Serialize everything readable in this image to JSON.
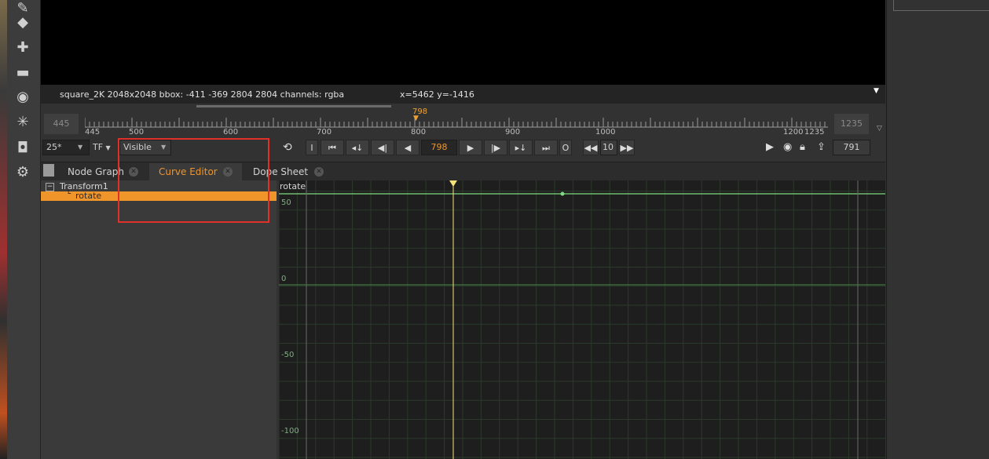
{
  "viewer": {
    "info": "square_2K 2048x2048  bbox: -411 -369 2804 2804 channels: rgba",
    "coords": "x=5462 y=-1416"
  },
  "timeline": {
    "in_frame": "445",
    "out_frame": "1235",
    "current_marker": "798",
    "tick_labels": [
      "445",
      "500",
      "600",
      "700",
      "800",
      "900",
      "1000",
      "1200",
      "1235"
    ]
  },
  "transport": {
    "fps": "25*",
    "tf": "TF",
    "visible": "Visible",
    "current_frame": "798",
    "step": "10",
    "end_frame": "791",
    "i_label": "I",
    "o_label": "O"
  },
  "tabs": [
    {
      "label": "Node Graph"
    },
    {
      "label": "Curve Editor"
    },
    {
      "label": "Dope Sheet"
    }
  ],
  "tree": {
    "node": "Transform1",
    "knob": "rotate"
  },
  "curve": {
    "label": "rotate",
    "y_labels": [
      "50",
      "0",
      "-50",
      "-100"
    ]
  },
  "colors": {
    "accent": "#f0952a",
    "curve": "#7fdc7f",
    "playhead": "#f5e27a"
  }
}
